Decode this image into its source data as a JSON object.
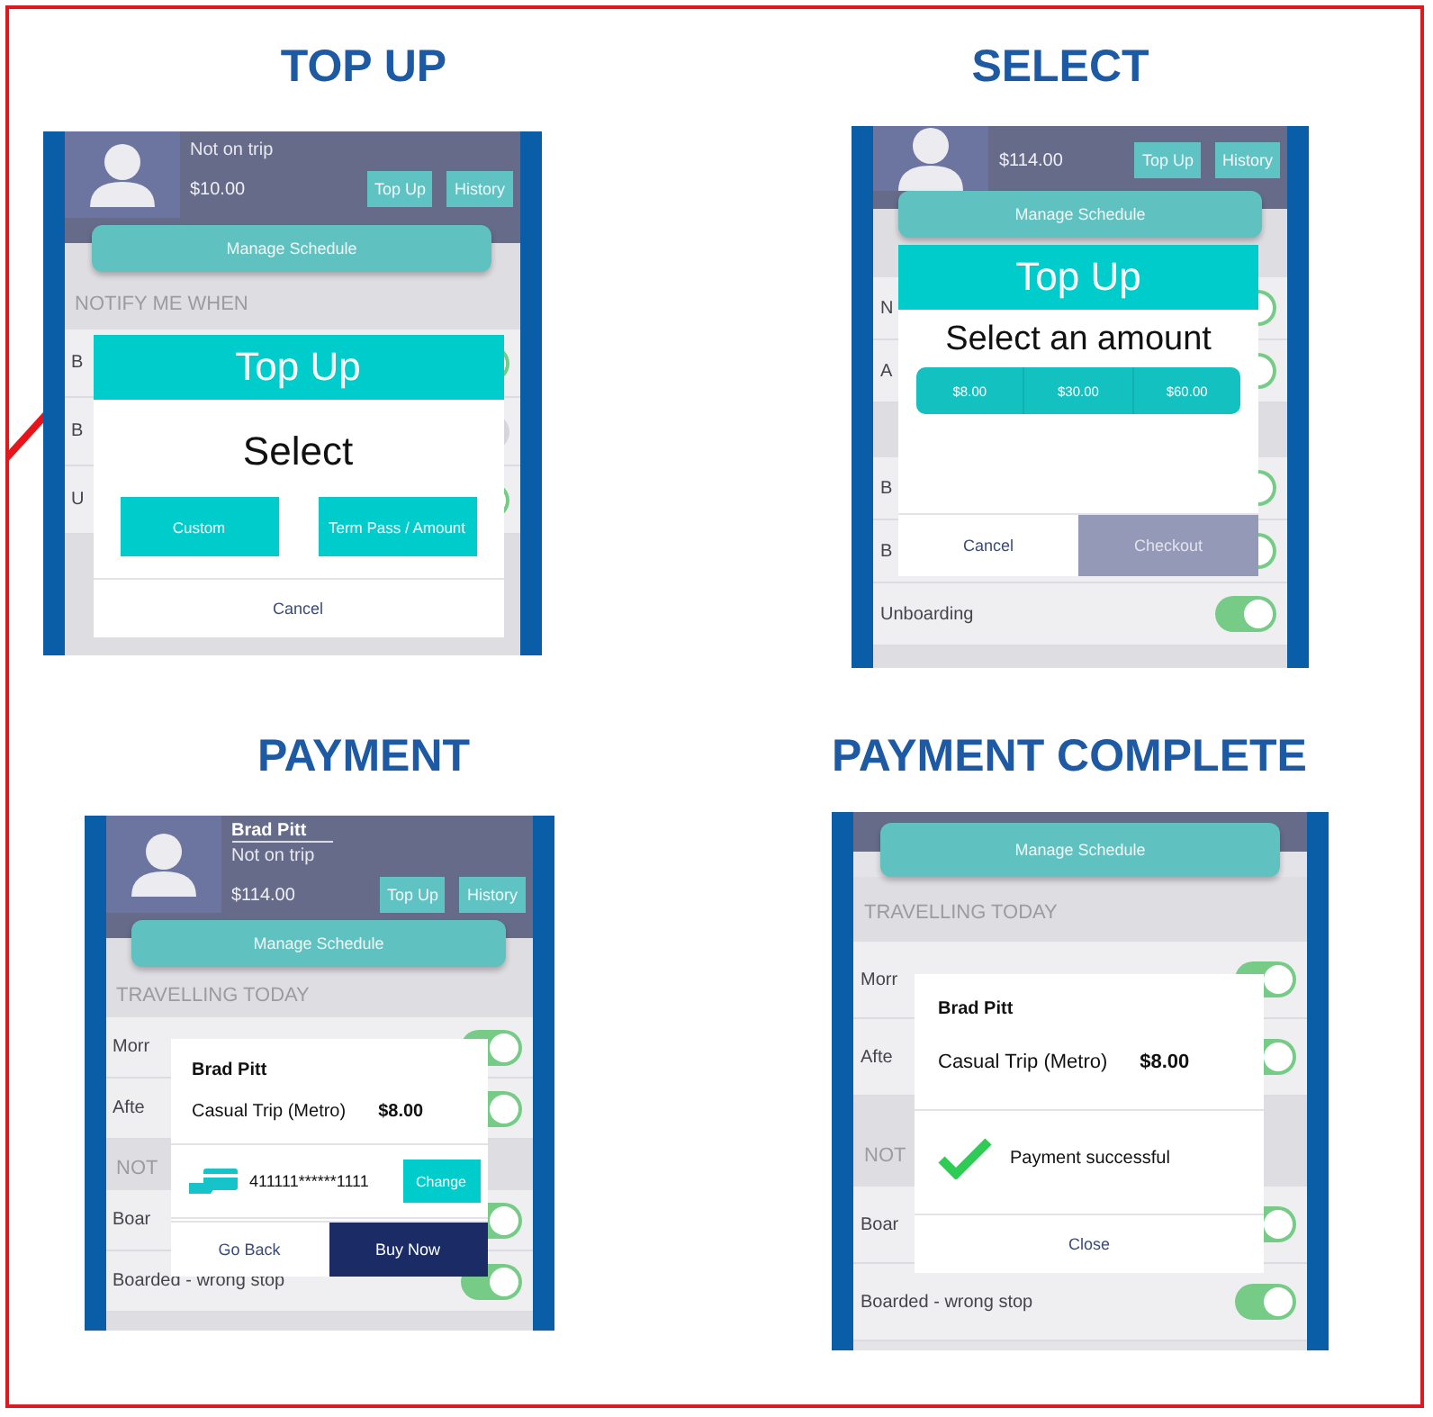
{
  "panels": [
    {
      "heading": "TOP UP",
      "profile": {
        "status": "Not on trip",
        "balance": "$10.00",
        "buttons": [
          "Top Up",
          "History"
        ]
      },
      "manage": "Manage Schedule",
      "sections": [
        {
          "title": "NOTIFY ME WHEN",
          "rows": [
            {
              "label": "B",
              "on": true
            },
            {
              "label": "B",
              "on": false
            },
            {
              "label": "U",
              "on": true
            }
          ]
        }
      ],
      "modal": {
        "kind": "select",
        "title": "Top Up",
        "prompt": "Select",
        "options": [
          "Custom",
          "Term Pass / Amount"
        ],
        "cancel": "Cancel"
      }
    },
    {
      "heading": "SELECT",
      "profile": {
        "balance": "$114.00",
        "buttons": [
          "Top Up",
          "History"
        ]
      },
      "manage": "Manage Schedule",
      "sections": [
        {
          "rows": [
            {
              "label": "N",
              "on": true
            },
            {
              "label": "A",
              "on": true
            }
          ]
        },
        {
          "rows": [
            {
              "label": "B",
              "on": true
            },
            {
              "label": "B",
              "on": true
            },
            {
              "label": "Unboarding",
              "on": true
            }
          ]
        }
      ],
      "modal": {
        "kind": "amount",
        "title": "Top Up",
        "prompt": "Select an amount",
        "options": [
          "$8.00",
          "$30.00",
          "$60.00"
        ],
        "cancel": "Cancel",
        "confirm": "Checkout",
        "confirm_disabled": true
      }
    },
    {
      "heading": "PAYMENT",
      "profile": {
        "name": "Brad Pitt",
        "status": "Not on trip",
        "balance": "$114.00",
        "buttons": [
          "Top Up",
          "History"
        ]
      },
      "manage": "Manage Schedule",
      "sections": [
        {
          "title": "TRAVELLING TODAY",
          "rows": [
            {
              "label": "Morr",
              "on": true
            },
            {
              "label": "Afte",
              "on": true
            }
          ]
        },
        {
          "title": "NOT",
          "rows": [
            {
              "label": "Boar",
              "on": true
            },
            {
              "label": "Boarded - wrong stop",
              "on": true
            }
          ]
        }
      ],
      "modal": {
        "kind": "payment",
        "name": "Brad Pitt",
        "item": "Casual Trip (Metro)",
        "price": "$8.00",
        "card": "411111******1111",
        "change": "Change",
        "cancel": "Go Back",
        "confirm": "Buy Now"
      }
    },
    {
      "heading": "PAYMENT COMPLETE",
      "manage": "Manage Schedule",
      "sections": [
        {
          "title": "TRAVELLING TODAY",
          "rows": [
            {
              "label": "Morr",
              "on": true
            },
            {
              "label": "Afte",
              "on": true
            }
          ]
        },
        {
          "title": "NOT",
          "rows": [
            {
              "label": "Boar",
              "on": true
            },
            {
              "label": "Boarded - wrong stop",
              "on": true
            }
          ]
        }
      ],
      "modal": {
        "kind": "complete",
        "name": "Brad Pitt",
        "item": "Casual Trip (Metro)",
        "price": "$8.00",
        "message": "Payment successful",
        "cancel": "Close"
      }
    }
  ]
}
